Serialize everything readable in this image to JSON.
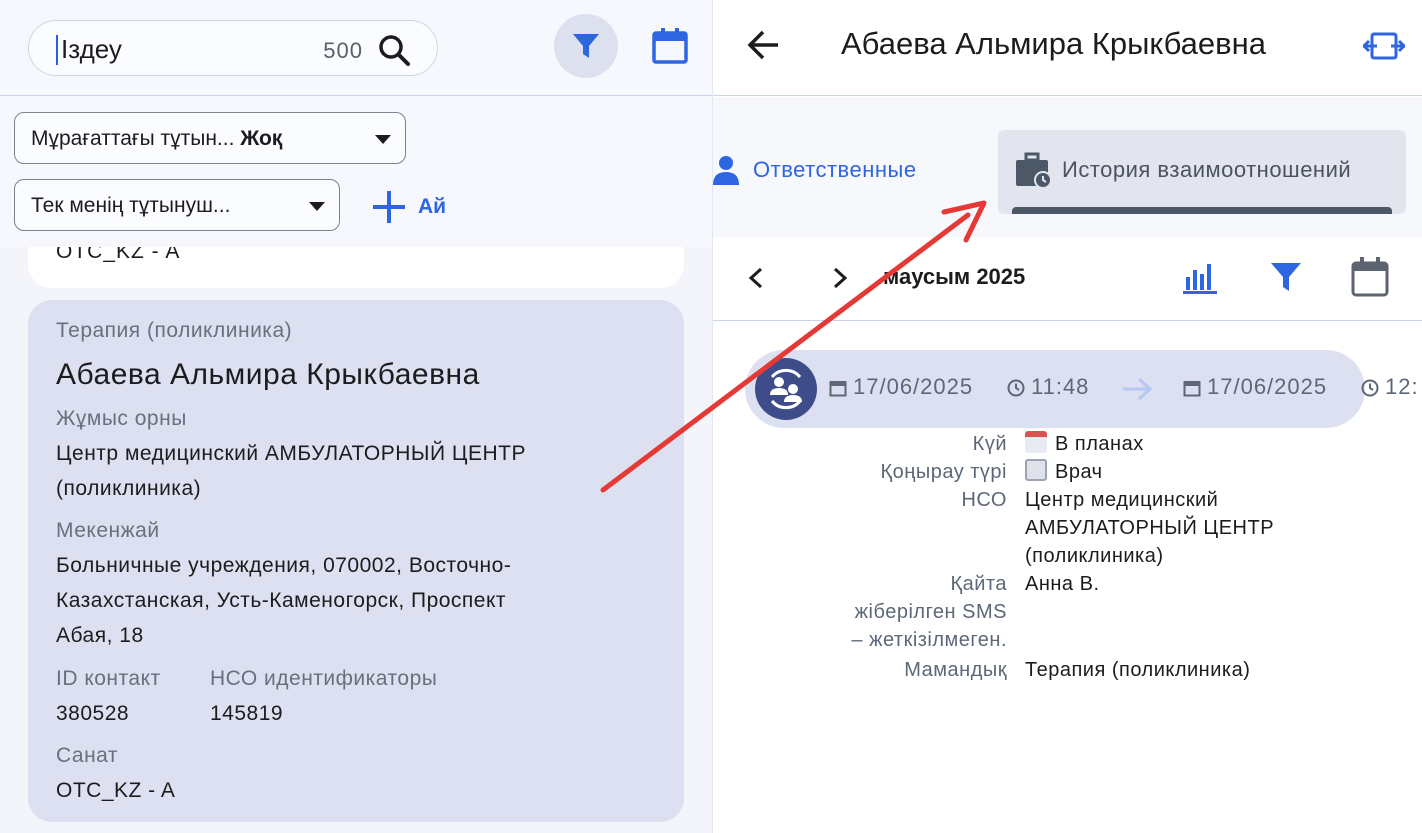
{
  "search": {
    "placeholder": "Іздеу",
    "count": "500"
  },
  "filters": {
    "archive_label": "Мұрағаттағы тұтын... ",
    "archive_value": "Жоқ",
    "mine_label": "Тек менің тұтынуш...",
    "add_label": "Ай"
  },
  "list": {
    "prev_card_segment": "OTC_KZ - A",
    "card": {
      "specialty": "Терапия (поликлиника)",
      "name": "Абаева Альмира Крыкбаевна",
      "work_label": "Жұмыс орны",
      "work_line1": "Центр медицинский АМБУЛАТОРНЫЙ ЦЕНТР",
      "work_line2": "(поликлиника)",
      "address_label": "Мекенжай",
      "address_line1": "Больничные учреждения, 070002, Восточно-",
      "address_line2": "Казахстанская, Усть-Каменогорск, Проспект",
      "address_line3": "Абая, 18",
      "contact_id_label": "ID контакт",
      "contact_id": "380528",
      "hco_id_label": "НСО идентификаторы",
      "hco_id": "145819",
      "category_label": "Санат",
      "category": "OTC_KZ - A"
    }
  },
  "detail": {
    "title": "Абаева Альмира Крыкбаевна",
    "tabs": {
      "responsible": "Ответственные",
      "history": "История взаимоотношений"
    },
    "month": "маусым 2025",
    "event": {
      "start_date": "17/06/2025",
      "start_time": "11:48",
      "end_date": "17/06/2025",
      "end_time": "12:"
    },
    "fields": {
      "status_label": "Күй",
      "status_value": "В планах",
      "call_type_label": "Қоңырау түрі",
      "call_type_value": "Врач",
      "hco_label": "НСО",
      "hco_line1": "Центр медицинский",
      "hco_line2": "АМБУЛАТОРНЫЙ ЦЕНТР",
      "hco_line3": "(поликлиника)",
      "resent_label_line1": "Қайта",
      "resent_label_line2": "жіберілген SMS",
      "resent_label_line3": "– жеткізілмеген.",
      "resent_value": "Анна В.",
      "specialty_label": "Мамандық",
      "specialty_value": "Терапия (поликлиника)"
    }
  },
  "colors": {
    "accent": "#2d66e0",
    "annotation_arrow": "#e53935",
    "card_bg": "#dde0f0",
    "avatar_bg": "#3e4d8a"
  }
}
